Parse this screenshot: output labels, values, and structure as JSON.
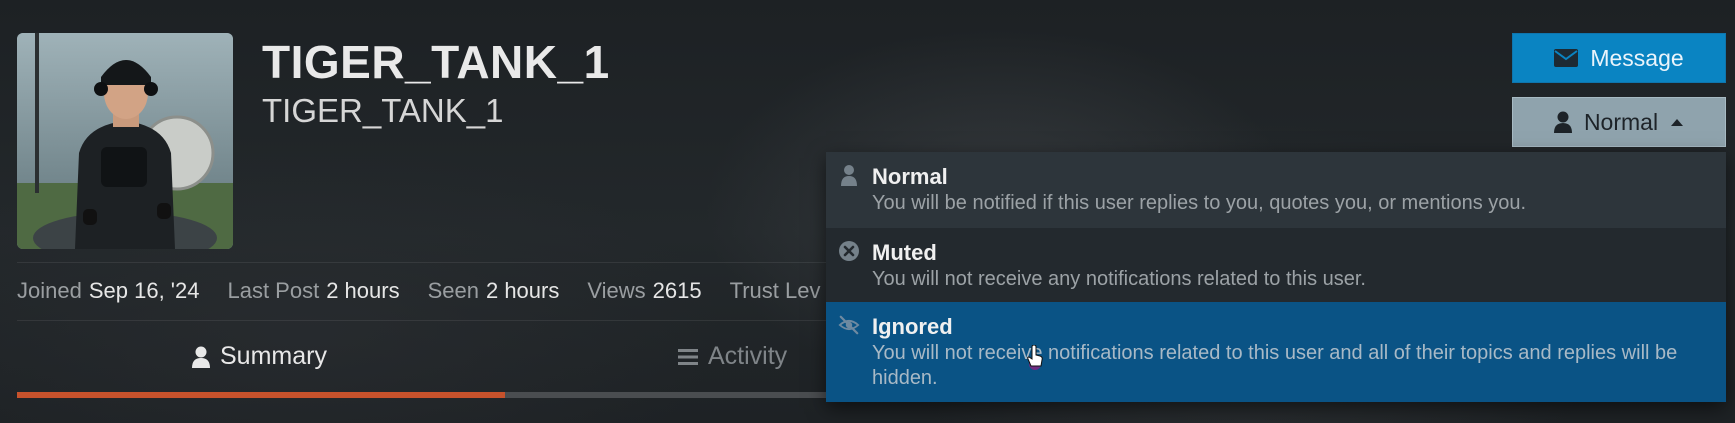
{
  "profile": {
    "username": "TIGER_TANK_1",
    "full_name": "TIGER_TANK_1",
    "avatar": "avatar-image"
  },
  "stats": [
    {
      "label": "Joined",
      "value": "Sep 16, '24"
    },
    {
      "label": "Last Post",
      "value": "2 hours"
    },
    {
      "label": "Seen",
      "value": "2 hours"
    },
    {
      "label": "Views",
      "value": "2615"
    },
    {
      "label": "Trust Lev",
      "value": ""
    }
  ],
  "tabs": [
    {
      "label": "Summary",
      "icon": "user-icon",
      "active": true
    },
    {
      "label": "Activity",
      "icon": "list-icon",
      "active": false
    }
  ],
  "actions": {
    "message_label": "Message",
    "message_icon": "envelope-icon",
    "level_label": "Normal",
    "level_icon": "user-icon",
    "caret_icon": "caret-up-icon"
  },
  "dropdown": [
    {
      "title": "Normal",
      "description": "You will be notified if this user replies to you, quotes you, or mentions you.",
      "icon": "user-icon"
    },
    {
      "title": "Muted",
      "description": "You will not receive any notifications related to this user.",
      "icon": "times-circle-icon"
    },
    {
      "title": "Ignored",
      "description": "You will not receive notifications related to this user and all of their topics and replies will be hidden.",
      "icon": "eye-slash-icon",
      "highlighted": true
    }
  ],
  "colors": {
    "accent": "#0a84c2",
    "tab_active": "#c7522c",
    "highlight": "#0a5385"
  }
}
